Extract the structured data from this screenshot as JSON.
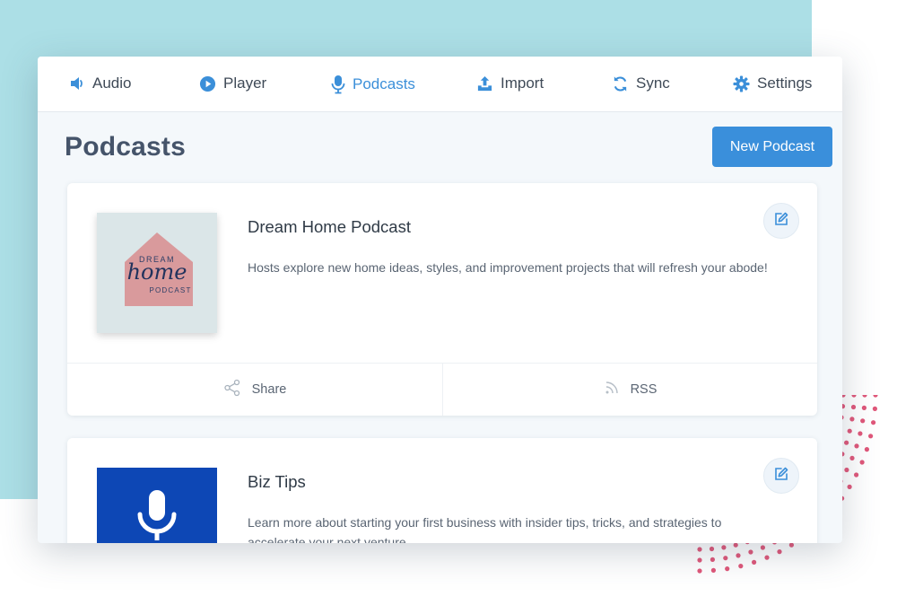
{
  "nav": {
    "items": [
      {
        "label": "Audio",
        "icon": "speaker-icon"
      },
      {
        "label": "Player",
        "icon": "play-circle-icon"
      },
      {
        "label": "Podcasts",
        "icon": "microphone-icon",
        "active": true
      },
      {
        "label": "Import",
        "icon": "upload-icon"
      },
      {
        "label": "Sync",
        "icon": "sync-icon"
      },
      {
        "label": "Settings",
        "icon": "gear-icon"
      }
    ]
  },
  "page": {
    "title": "Podcasts",
    "new_button_label": "New Podcast"
  },
  "podcasts": [
    {
      "title": "Dream Home Podcast",
      "description": "Hosts explore new home ideas, styles, and improvement projects that will refresh your abode!",
      "cover": {
        "line1": "DREAM",
        "line2": "home",
        "line3": "PODCAST"
      },
      "share_label": "Share",
      "rss_label": "RSS"
    },
    {
      "title": "Biz Tips",
      "description": "Learn more about starting your first business with insider tips, tricks, and strategies to accelerate your next venture."
    }
  ],
  "colors": {
    "accent": "#3a8fdb",
    "background_teal": "#acdfe6",
    "dots_pink": "#e0577a",
    "biz_cover_blue": "#0d47b5",
    "dream_cover_bg": "#dbe6e8",
    "dream_house": "#d99a9c"
  }
}
